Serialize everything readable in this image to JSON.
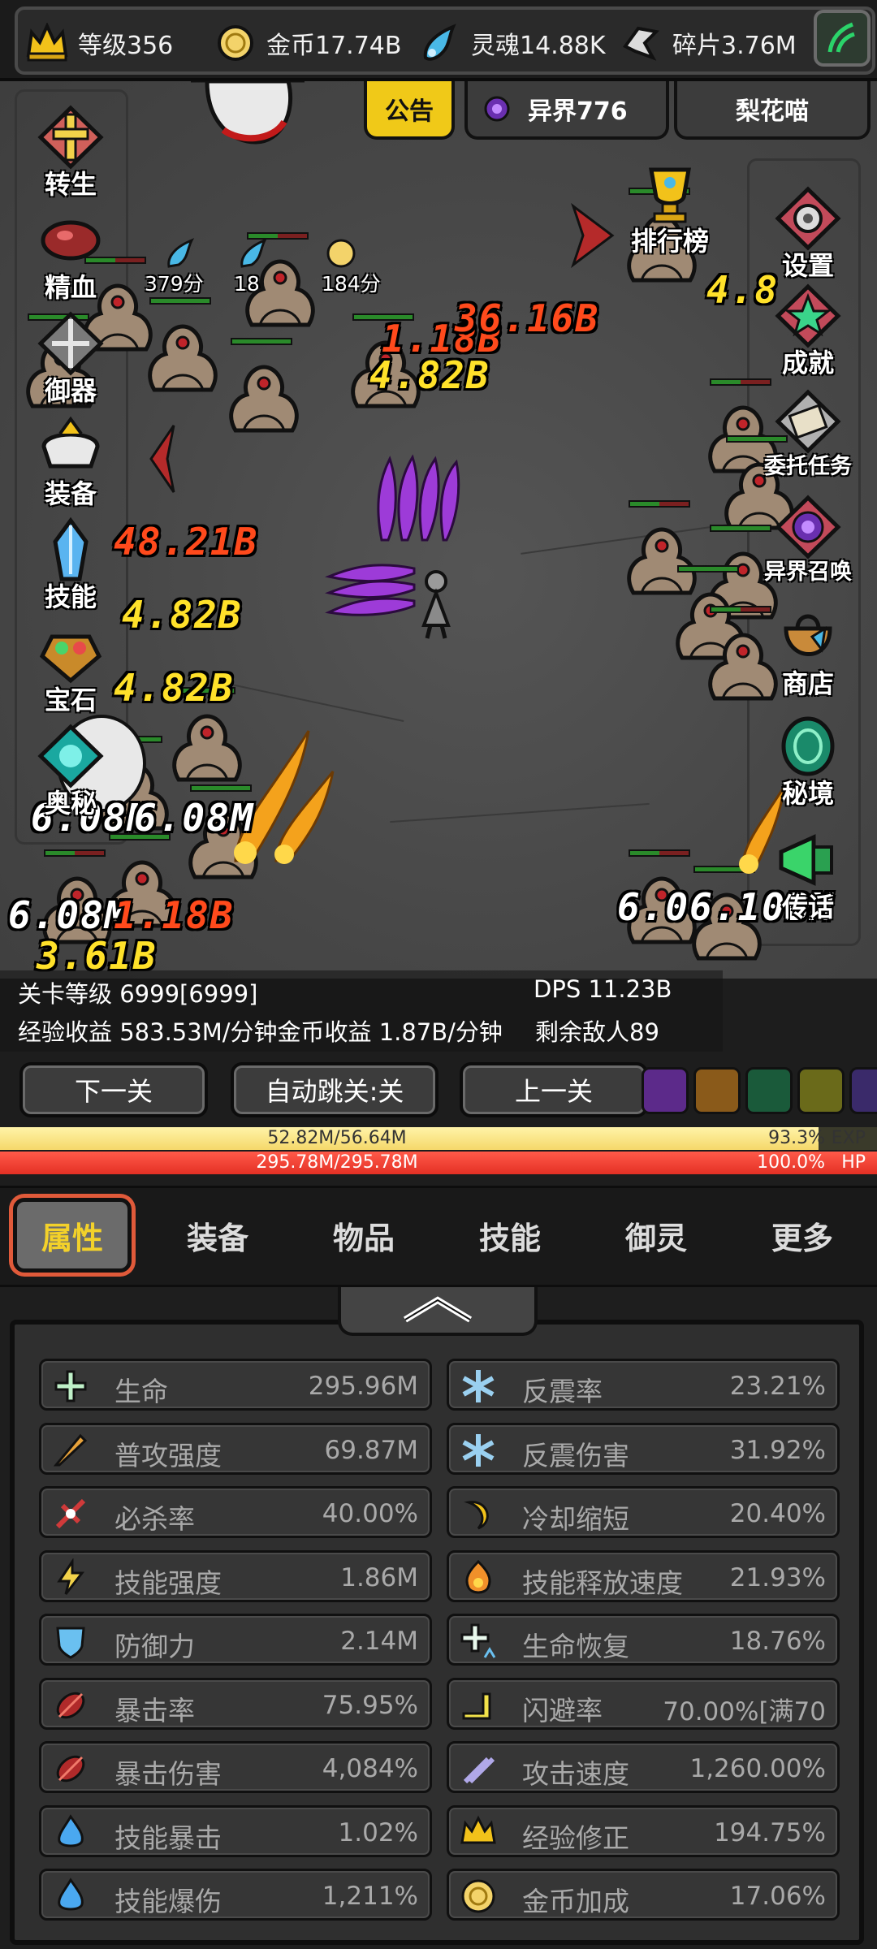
{
  "resources": {
    "level": "等级356",
    "gold": "金币17.74B",
    "soul": "灵魂14.88K",
    "shards": "碎片3.76M"
  },
  "top_tabs": {
    "announcement": "公告",
    "otherworld": "异界776",
    "player": "梨花喵"
  },
  "left_menu": [
    "转生",
    "精血",
    "御器",
    "装备",
    "技能",
    "宝石",
    "奥秘"
  ],
  "right_menu": [
    "排行榜",
    "设置",
    "成就",
    "委托任务",
    "异界召唤",
    "商店",
    "秘境",
    "传话"
  ],
  "scores": [
    "379分",
    "184分",
    "184分"
  ],
  "damage_numbers": [
    {
      "text": "4.82B",
      "color": "y"
    },
    {
      "text": "1.18B",
      "color": "o"
    },
    {
      "text": "36.16B",
      "color": "o"
    },
    {
      "text": "48.21B",
      "color": "o"
    },
    {
      "text": "4.82B",
      "color": "y"
    },
    {
      "text": "4.82B",
      "color": "y"
    },
    {
      "text": "6.08M",
      "color": "w"
    },
    {
      "text": "6.08M",
      "color": "w"
    },
    {
      "text": "6.08M",
      "color": "w"
    },
    {
      "text": "1.18B",
      "color": "o"
    },
    {
      "text": "3.61B",
      "color": "y"
    },
    {
      "text": "6.06.10BM",
      "color": "w"
    },
    {
      "text": "4.8",
      "color": "y"
    }
  ],
  "battle_info": {
    "stage_level": "关卡等级 6999[6999]",
    "dps": "DPS 11.23B",
    "income": "经验收益 583.53M/分钟金币收益 1.87B/分钟",
    "enemies_left": "剩余敌人89"
  },
  "controls": {
    "next": "下一关",
    "auto_skip": "自动跳关:关",
    "prev": "上一关"
  },
  "exp_bar": {
    "text": "52.82M/56.64M",
    "percent": "93.3%",
    "tag": "EXP",
    "fill": 0.933
  },
  "hp_bar": {
    "text": "295.78M/295.78M",
    "percent": "100.0%",
    "tag": "HP",
    "fill": 1.0
  },
  "nav_tabs": [
    "属性",
    "装备",
    "物品",
    "技能",
    "御灵",
    "更多"
  ],
  "stats_left": [
    {
      "name": "生命",
      "value": "295.96M",
      "icon": "life-icon"
    },
    {
      "name": "普攻强度",
      "value": "69.87M",
      "icon": "attack-icon"
    },
    {
      "name": "必杀率",
      "value": "40.00%",
      "icon": "kill-icon"
    },
    {
      "name": "技能强度",
      "value": "1.86M",
      "icon": "skill-power-icon"
    },
    {
      "name": "防御力",
      "value": "2.14M",
      "icon": "shield-icon"
    },
    {
      "name": "暴击率",
      "value": "75.95%",
      "icon": "crit-rate-icon"
    },
    {
      "name": "暴击伤害",
      "value": "4,084%",
      "icon": "crit-damage-icon"
    },
    {
      "name": "技能暴击",
      "value": "1.02%",
      "icon": "skill-crit-icon"
    },
    {
      "name": "技能爆伤",
      "value": "1,211%",
      "icon": "skill-crit-damage-icon"
    }
  ],
  "stats_right": [
    {
      "name": "反震率",
      "value": "23.21%",
      "icon": "counter-rate-icon"
    },
    {
      "name": "反震伤害",
      "value": "31.92%",
      "icon": "counter-damage-icon"
    },
    {
      "name": "冷却缩短",
      "value": "20.40%",
      "icon": "cooldown-icon"
    },
    {
      "name": "技能释放速度",
      "value": "21.93%",
      "icon": "cast-speed-icon"
    },
    {
      "name": "生命恢复",
      "value": "18.76%",
      "icon": "regen-icon"
    },
    {
      "name": "闪避率",
      "value": "70.00%[满70",
      "icon": "dodge-icon"
    },
    {
      "name": "攻击速度",
      "value": "1,260.00%",
      "icon": "attack-speed-icon"
    },
    {
      "name": "经验修正",
      "value": "194.75%",
      "icon": "crown-icon"
    },
    {
      "name": "金币加成",
      "value": "17.06%",
      "icon": "coin-icon"
    }
  ]
}
